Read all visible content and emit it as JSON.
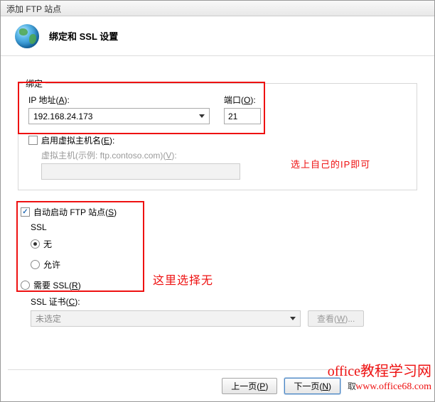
{
  "window": {
    "title": "添加 FTP 站点"
  },
  "header": {
    "title": "绑定和 SSL 设置"
  },
  "binding": {
    "legend": "绑定",
    "ip_label_pre": "IP 地址(",
    "ip_label_key": "A",
    "ip_label_post": "):",
    "ip_value": "192.168.24.173",
    "port_label_pre": "端口(",
    "port_label_key": "O",
    "port_label_post": "):",
    "port_value": "21",
    "vhost_checkbox_pre": "启用虚拟主机名(",
    "vhost_checkbox_key": "E",
    "vhost_checkbox_post": "):",
    "vhost_checked": false,
    "vhost_label_pre": "虚拟主机(示例: ftp.contoso.com)(",
    "vhost_label_key": "V",
    "vhost_label_post": "):"
  },
  "autostart": {
    "label_pre": "自动启动 FTP 站点(",
    "label_key": "S",
    "label_post": ")",
    "checked": true
  },
  "ssl": {
    "heading": "SSL",
    "options": {
      "none": "无",
      "allow": "允许",
      "require_pre": "需要 SSL(",
      "require_key": "R",
      "require_post": ")"
    },
    "selected": "none",
    "cert_label_pre": "SSL 证书(",
    "cert_label_key": "C",
    "cert_label_post": "):",
    "cert_value": "未选定",
    "view_btn_pre": "查看(",
    "view_btn_key": "W",
    "view_btn_post": ")..."
  },
  "annotations": {
    "note1": "选上自己的IP即可",
    "note2": "这里选择无"
  },
  "footer": {
    "prev_pre": "上一页(",
    "prev_key": "P",
    "prev_post": ")",
    "next_pre": "下一页(",
    "next_key": "N",
    "next_post": ")",
    "cancel": "取"
  },
  "watermark": {
    "title": "office教程学习网",
    "url": "www.office68.com"
  }
}
